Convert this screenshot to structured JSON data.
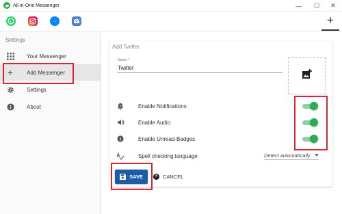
{
  "window": {
    "title": "All-in-One Messenger",
    "minimize_glyph": "—",
    "maximize_glyph": "☐",
    "close_glyph": "✕"
  },
  "iconbar": {
    "messengers": [
      {
        "name": "whatsapp-icon",
        "color": "#25d366"
      },
      {
        "name": "instagram-icon",
        "color": "#d6249f"
      },
      {
        "name": "messenger-icon",
        "color": "#0084ff"
      },
      {
        "name": "mail-icon",
        "color": "#4a7fd6"
      }
    ],
    "add_glyph": "+"
  },
  "sidebar": {
    "title": "Settings",
    "items": [
      {
        "label": "Your Messenger",
        "icon": "grid-icon"
      },
      {
        "label": "Add Messenger",
        "icon": "plus-icon",
        "active": true
      },
      {
        "label": "Settings",
        "icon": "gear-icon"
      },
      {
        "label": "About",
        "icon": "info-icon"
      }
    ]
  },
  "main": {
    "title": "Add Twitter",
    "name_label": "Name *",
    "name_value": "Twitter",
    "options": [
      {
        "label": "Enable Notifications",
        "icon": "bell-icon",
        "on": true
      },
      {
        "label": "Enable Audio",
        "icon": "speaker-icon",
        "on": true
      },
      {
        "label": "Enable Unread-Badges",
        "icon": "info-icon",
        "on": true
      }
    ],
    "spellcheck": {
      "label": "Spell checking language",
      "value": "Detect automatically"
    },
    "save_label": "SAVE",
    "cancel_label": "CANCEL"
  },
  "colors": {
    "accent": "#1e5aa8",
    "toggle_on": "#27ae4f",
    "highlight": "#e0212f"
  }
}
